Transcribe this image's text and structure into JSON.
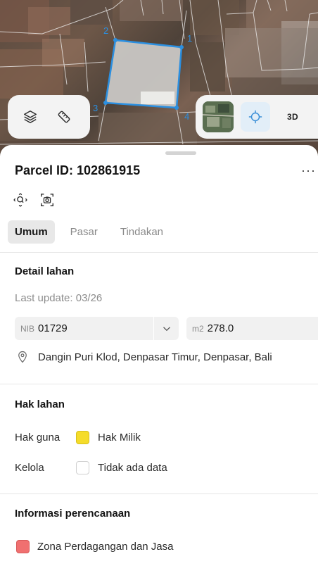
{
  "map": {
    "vertex_labels": [
      "1",
      "2",
      "3",
      "4"
    ],
    "controls": {
      "layers_icon": "layers-icon",
      "measure_icon": "ruler-icon",
      "locate_icon": "crosshair-icon",
      "view_3d_label": "3D"
    },
    "parcel_outline_color": "#2b8fe0"
  },
  "sheet": {
    "title": "Parcel ID: 102861915",
    "more_label": "···",
    "tool_icons": [
      "zoom-to-parcel-icon",
      "screenshot-icon"
    ],
    "tabs": [
      {
        "label": "Umum",
        "active": true
      },
      {
        "label": "Pasar",
        "active": false
      },
      {
        "label": "Tindakan",
        "active": false
      }
    ],
    "detail": {
      "heading": "Detail lahan",
      "last_update": "Last update: 03/26",
      "nib_prefix": "NIB",
      "nib_value": "01729",
      "area_prefix": "m2",
      "area_value": "278.0",
      "address": "Dangin Puri Klod, Denpasar Timur, Denpasar, Bali"
    },
    "rights": {
      "heading": "Hak lahan",
      "rows": [
        {
          "label": "Hak guna",
          "value": "Hak Milik",
          "color": "#f5dc2a"
        },
        {
          "label": "Kelola",
          "value": "Tidak ada data",
          "color": "#ffffff"
        }
      ]
    },
    "planning": {
      "heading": "Informasi perencanaan",
      "zone": "Zona Perdagangan dan Jasa",
      "zone_color": "#f07070"
    }
  }
}
